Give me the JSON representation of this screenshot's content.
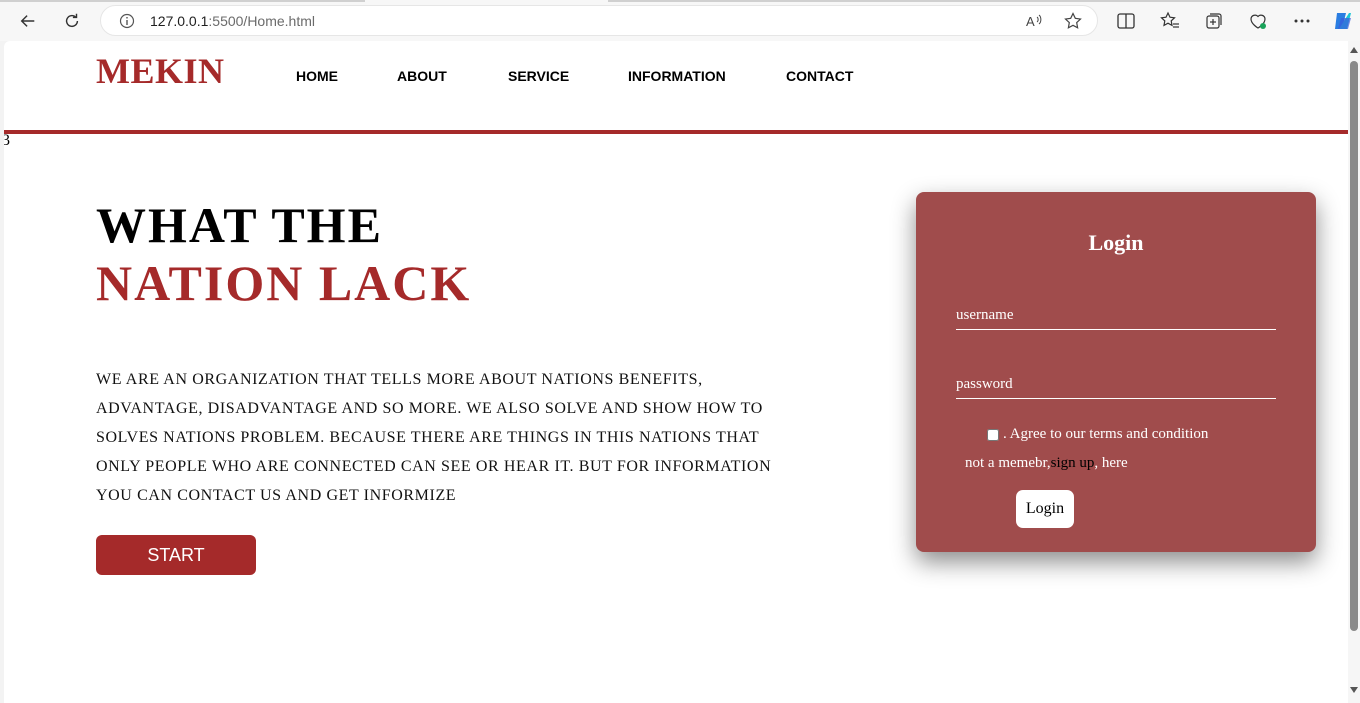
{
  "browser": {
    "url_host": "127.0.0.1",
    "url_rest": ":5500/Home.html"
  },
  "header": {
    "logo": "MEKIN",
    "nav": [
      "HOME",
      "ABOUT",
      "SERVICE",
      "INFORMATION",
      "CONTACT"
    ],
    "stray_text": "3"
  },
  "hero": {
    "title_line1": "WHAT THE",
    "title_line2": "NATION LACK",
    "paragraph": "WE ARE AN ORGANIZATION THAT TELLS MORE ABOUT NATIONS BENEFITS, ADVANTAGE, DISADVANTAGE AND SO MORE. WE ALSO SOLVE AND SHOW HOW TO SOLVES NATIONS PROBLEM. BECAUSE THERE ARE THINGS IN THIS NATIONS THAT ONLY PEOPLE WHO ARE CONNECTED CAN SEE OR HEAR IT. BUT FOR INFORMATION YOU CAN CONTACT US AND GET INFORMIZE",
    "start_label": "START"
  },
  "login": {
    "title": "Login",
    "username_placeholder": "username",
    "username_value": "",
    "password_placeholder": "password",
    "password_value": "",
    "agree_text": ". Agree to our terms and condition",
    "agree_checked": false,
    "member_prefix": "not a memebr,",
    "signup_link": "sign up",
    "member_suffix": ", here",
    "button_label": "Login"
  },
  "colors": {
    "brand": "#a52a2a",
    "card": "#a04c4c"
  }
}
